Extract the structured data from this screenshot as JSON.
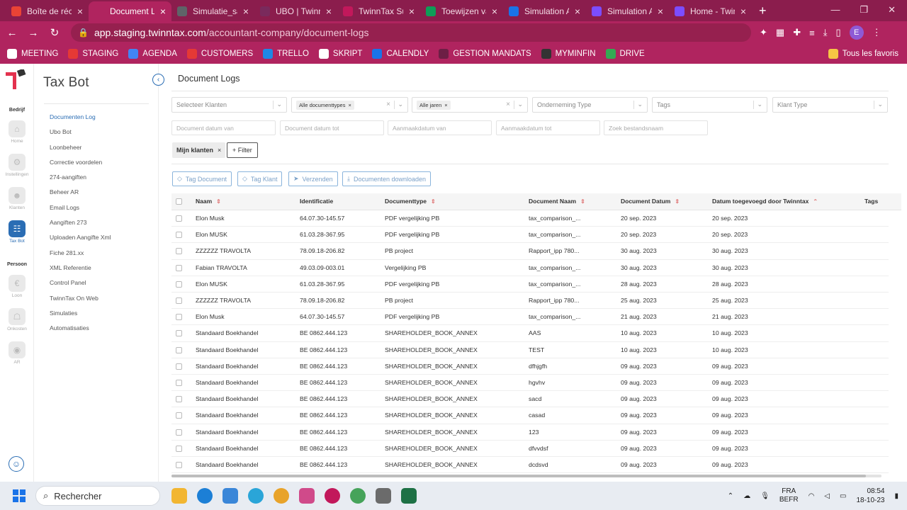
{
  "browser": {
    "tabs": [
      {
        "label": "Boîte de réce",
        "color": "#ea4335"
      },
      {
        "label": "Document Lo",
        "color": "#b0245f",
        "active": true
      },
      {
        "label": "Simulatie_san",
        "color": "#5f6368"
      },
      {
        "label": "UBO | TwinnT",
        "color": "#7a2a5c"
      },
      {
        "label": "TwinnTax Sup",
        "color": "#c2185b"
      },
      {
        "label": "Toewijzen var",
        "color": "#0f9d58"
      },
      {
        "label": "Simulation AI",
        "color": "#1a73e8"
      },
      {
        "label": "Simulation AI",
        "color": "#7c4dff"
      },
      {
        "label": "Home - Twin",
        "color": "#7c4dff"
      }
    ],
    "new_tab": "+",
    "url_host": "app.staging.twinntax.com",
    "url_path": "/accountant-company/document-logs",
    "profile_initial": "E",
    "bookmarks": [
      {
        "label": "MEETING",
        "color": "#ffffff"
      },
      {
        "label": "STAGING",
        "color": "#e53935"
      },
      {
        "label": "AGENDA",
        "color": "#4285f4"
      },
      {
        "label": "CUSTOMERS",
        "color": "#e53935"
      },
      {
        "label": "TRELLO",
        "color": "#1e88e5"
      },
      {
        "label": "SKRIPT",
        "color": "#ffffff"
      },
      {
        "label": "CALENDLY",
        "color": "#1a73e8"
      },
      {
        "label": "GESTION MANDATS",
        "color": "#6d1f45"
      },
      {
        "label": "MYMINFIN",
        "color": "#333333"
      },
      {
        "label": "DRIVE",
        "color": "#34a853"
      }
    ],
    "bookmarks_right": "Tous les favoris"
  },
  "rail": {
    "section_company": "Bedrijf",
    "section_person": "Persoon",
    "items": [
      {
        "label": "Home"
      },
      {
        "label": "Instellingen"
      },
      {
        "label": "Klanten"
      },
      {
        "label": "Tax Bot",
        "active": true
      },
      {
        "label": "Loon"
      },
      {
        "label": "Onkosten"
      },
      {
        "label": "AR"
      }
    ]
  },
  "sidebar": {
    "title": "Tax Bot",
    "items": [
      {
        "label": "Documenten Log",
        "active": true
      },
      {
        "label": "Ubo Bot"
      },
      {
        "label": "Loonbeheer"
      },
      {
        "label": "Correctie voordelen"
      },
      {
        "label": "274-aangiften"
      },
      {
        "label": "Beheer AR"
      },
      {
        "label": "Email Logs"
      },
      {
        "label": "Aangiften 273"
      },
      {
        "label": "Uploaden Aangifte Xml"
      },
      {
        "label": "Fiche 281.xx"
      },
      {
        "label": "XML Referentie"
      },
      {
        "label": "Control Panel"
      },
      {
        "label": "TwinnTax On Web"
      },
      {
        "label": "Simulaties"
      },
      {
        "label": "Automatisaties"
      }
    ]
  },
  "page": {
    "title": "Document Logs",
    "filters": {
      "clients_placeholder": "Selecteer Klanten",
      "doctype_chip": "Alle documenttypes",
      "year_chip": "Alle jaren",
      "company_type_placeholder": "Onderneming Type",
      "tags_placeholder": "Tags",
      "client_type_placeholder": "Klant Type",
      "doc_date_from": "Document datum van",
      "doc_date_to": "Document datum tot",
      "created_from": "Aanmaakdatum van",
      "created_to": "Aanmaakdatum tot",
      "filename_search": "Zoek bestandsnaam"
    },
    "active_filter": "Mijn klanten",
    "add_filter": "+ Filter",
    "actions": {
      "tag_document": "Tag Document",
      "tag_client": "Tag Klant",
      "send": "Verzenden",
      "download": "Documenten downloaden"
    },
    "columns": {
      "name": "Naam",
      "id": "Identificatie",
      "type": "Documenttype",
      "docname": "Document Naam",
      "docdate": "Document Datum",
      "added": "Datum toegevoegd door Twinntax",
      "tags": "Tags"
    },
    "rows": [
      {
        "name": "Elon Musk",
        "id": "64.07.30-145.57",
        "type": "PDF vergelijking PB",
        "docname": "tax_comparison_...",
        "docdate": "20 sep. 2023",
        "added": "20 sep. 2023"
      },
      {
        "name": "Elon MUSK",
        "id": "61.03.28-367.95",
        "type": "PDF vergelijking PB",
        "docname": "tax_comparison_...",
        "docdate": "20 sep. 2023",
        "added": "20 sep. 2023"
      },
      {
        "name": "ZZZZZZ TRAVOLTA",
        "id": "78.09.18-206.82",
        "type": "PB project",
        "docname": "Rapport_ipp 780...",
        "docdate": "30 aug. 2023",
        "added": "30 aug. 2023"
      },
      {
        "name": "Fabian TRAVOLTA",
        "id": "49.03.09-003.01",
        "type": "Vergelijking PB",
        "docname": "tax_comparison_...",
        "docdate": "30 aug. 2023",
        "added": "30 aug. 2023"
      },
      {
        "name": "Elon MUSK",
        "id": "61.03.28-367.95",
        "type": "PDF vergelijking PB",
        "docname": "tax_comparison_...",
        "docdate": "28 aug. 2023",
        "added": "28 aug. 2023"
      },
      {
        "name": "ZZZZZZ TRAVOLTA",
        "id": "78.09.18-206.82",
        "type": "PB project",
        "docname": "Rapport_ipp 780...",
        "docdate": "25 aug. 2023",
        "added": "25 aug. 2023"
      },
      {
        "name": "Elon Musk",
        "id": "64.07.30-145.57",
        "type": "PDF vergelijking PB",
        "docname": "tax_comparison_...",
        "docdate": "21 aug. 2023",
        "added": "21 aug. 2023"
      },
      {
        "name": "Standaard Boekhandel",
        "id": "BE 0862.444.123",
        "type": "SHAREHOLDER_BOOK_ANNEX",
        "docname": "AAS",
        "docdate": "10 aug. 2023",
        "added": "10 aug. 2023"
      },
      {
        "name": "Standaard Boekhandel",
        "id": "BE 0862.444.123",
        "type": "SHAREHOLDER_BOOK_ANNEX",
        "docname": "TEST",
        "docdate": "10 aug. 2023",
        "added": "10 aug. 2023"
      },
      {
        "name": "Standaard Boekhandel",
        "id": "BE 0862.444.123",
        "type": "SHAREHOLDER_BOOK_ANNEX",
        "docname": "dfhjgfh",
        "docdate": "09 aug. 2023",
        "added": "09 aug. 2023"
      },
      {
        "name": "Standaard Boekhandel",
        "id": "BE 0862.444.123",
        "type": "SHAREHOLDER_BOOK_ANNEX",
        "docname": "hgvhv",
        "docdate": "09 aug. 2023",
        "added": "09 aug. 2023"
      },
      {
        "name": "Standaard Boekhandel",
        "id": "BE 0862.444.123",
        "type": "SHAREHOLDER_BOOK_ANNEX",
        "docname": "sacd",
        "docdate": "09 aug. 2023",
        "added": "09 aug. 2023"
      },
      {
        "name": "Standaard Boekhandel",
        "id": "BE 0862.444.123",
        "type": "SHAREHOLDER_BOOK_ANNEX",
        "docname": "casad",
        "docdate": "09 aug. 2023",
        "added": "09 aug. 2023"
      },
      {
        "name": "Standaard Boekhandel",
        "id": "BE 0862.444.123",
        "type": "SHAREHOLDER_BOOK_ANNEX",
        "docname": "123",
        "docdate": "09 aug. 2023",
        "added": "09 aug. 2023"
      },
      {
        "name": "Standaard Boekhandel",
        "id": "BE 0862.444.123",
        "type": "SHAREHOLDER_BOOK_ANNEX",
        "docname": "dfvvdsf",
        "docdate": "09 aug. 2023",
        "added": "09 aug. 2023"
      },
      {
        "name": "Standaard Boekhandel",
        "id": "BE 0862.444.123",
        "type": "SHAREHOLDER_BOOK_ANNEX",
        "docname": "dcdsvd",
        "docdate": "09 aug. 2023",
        "added": "09 aug. 2023"
      }
    ]
  },
  "taskbar": {
    "search_placeholder": "Rechercher",
    "lang_line1": "FRA",
    "lang_line2": "BEFR",
    "time": "08:54",
    "date": "18-10-23"
  },
  "colors": {
    "brand": "#b0245f",
    "accent": "#2a6db4"
  }
}
